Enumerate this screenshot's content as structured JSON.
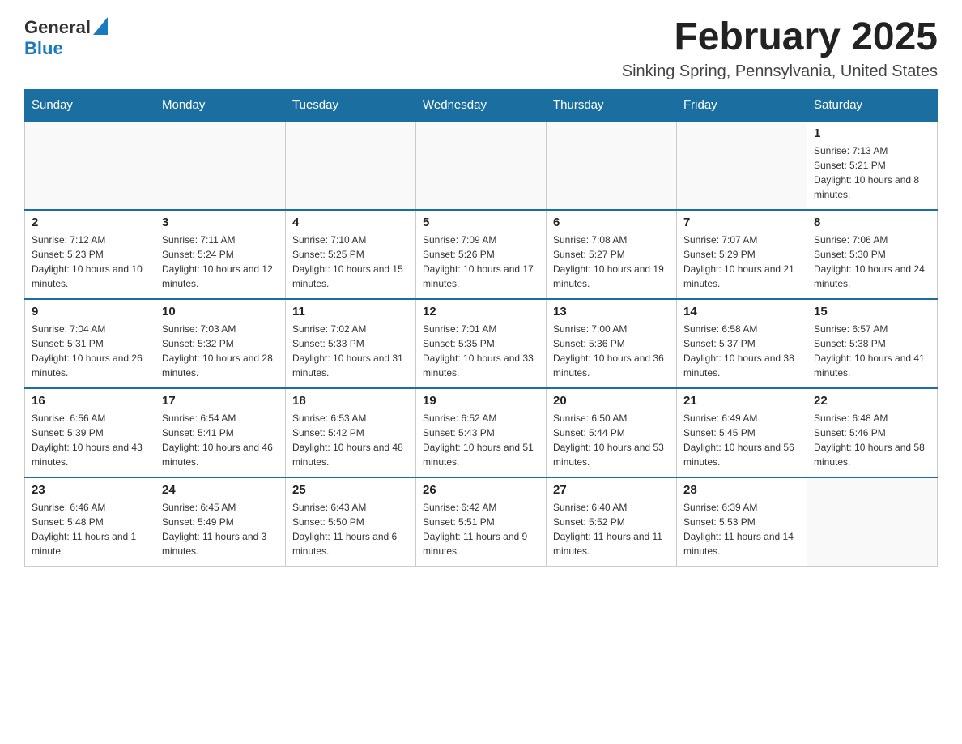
{
  "header": {
    "logo_general": "General",
    "logo_blue": "Blue",
    "month_title": "February 2025",
    "subtitle": "Sinking Spring, Pennsylvania, United States"
  },
  "days_of_week": [
    "Sunday",
    "Monday",
    "Tuesday",
    "Wednesday",
    "Thursday",
    "Friday",
    "Saturday"
  ],
  "weeks": [
    {
      "days": [
        {
          "number": "",
          "info": ""
        },
        {
          "number": "",
          "info": ""
        },
        {
          "number": "",
          "info": ""
        },
        {
          "number": "",
          "info": ""
        },
        {
          "number": "",
          "info": ""
        },
        {
          "number": "",
          "info": ""
        },
        {
          "number": "1",
          "info": "Sunrise: 7:13 AM\nSunset: 5:21 PM\nDaylight: 10 hours and 8 minutes."
        }
      ]
    },
    {
      "days": [
        {
          "number": "2",
          "info": "Sunrise: 7:12 AM\nSunset: 5:23 PM\nDaylight: 10 hours and 10 minutes."
        },
        {
          "number": "3",
          "info": "Sunrise: 7:11 AM\nSunset: 5:24 PM\nDaylight: 10 hours and 12 minutes."
        },
        {
          "number": "4",
          "info": "Sunrise: 7:10 AM\nSunset: 5:25 PM\nDaylight: 10 hours and 15 minutes."
        },
        {
          "number": "5",
          "info": "Sunrise: 7:09 AM\nSunset: 5:26 PM\nDaylight: 10 hours and 17 minutes."
        },
        {
          "number": "6",
          "info": "Sunrise: 7:08 AM\nSunset: 5:27 PM\nDaylight: 10 hours and 19 minutes."
        },
        {
          "number": "7",
          "info": "Sunrise: 7:07 AM\nSunset: 5:29 PM\nDaylight: 10 hours and 21 minutes."
        },
        {
          "number": "8",
          "info": "Sunrise: 7:06 AM\nSunset: 5:30 PM\nDaylight: 10 hours and 24 minutes."
        }
      ]
    },
    {
      "days": [
        {
          "number": "9",
          "info": "Sunrise: 7:04 AM\nSunset: 5:31 PM\nDaylight: 10 hours and 26 minutes."
        },
        {
          "number": "10",
          "info": "Sunrise: 7:03 AM\nSunset: 5:32 PM\nDaylight: 10 hours and 28 minutes."
        },
        {
          "number": "11",
          "info": "Sunrise: 7:02 AM\nSunset: 5:33 PM\nDaylight: 10 hours and 31 minutes."
        },
        {
          "number": "12",
          "info": "Sunrise: 7:01 AM\nSunset: 5:35 PM\nDaylight: 10 hours and 33 minutes."
        },
        {
          "number": "13",
          "info": "Sunrise: 7:00 AM\nSunset: 5:36 PM\nDaylight: 10 hours and 36 minutes."
        },
        {
          "number": "14",
          "info": "Sunrise: 6:58 AM\nSunset: 5:37 PM\nDaylight: 10 hours and 38 minutes."
        },
        {
          "number": "15",
          "info": "Sunrise: 6:57 AM\nSunset: 5:38 PM\nDaylight: 10 hours and 41 minutes."
        }
      ]
    },
    {
      "days": [
        {
          "number": "16",
          "info": "Sunrise: 6:56 AM\nSunset: 5:39 PM\nDaylight: 10 hours and 43 minutes."
        },
        {
          "number": "17",
          "info": "Sunrise: 6:54 AM\nSunset: 5:41 PM\nDaylight: 10 hours and 46 minutes."
        },
        {
          "number": "18",
          "info": "Sunrise: 6:53 AM\nSunset: 5:42 PM\nDaylight: 10 hours and 48 minutes."
        },
        {
          "number": "19",
          "info": "Sunrise: 6:52 AM\nSunset: 5:43 PM\nDaylight: 10 hours and 51 minutes."
        },
        {
          "number": "20",
          "info": "Sunrise: 6:50 AM\nSunset: 5:44 PM\nDaylight: 10 hours and 53 minutes."
        },
        {
          "number": "21",
          "info": "Sunrise: 6:49 AM\nSunset: 5:45 PM\nDaylight: 10 hours and 56 minutes."
        },
        {
          "number": "22",
          "info": "Sunrise: 6:48 AM\nSunset: 5:46 PM\nDaylight: 10 hours and 58 minutes."
        }
      ]
    },
    {
      "days": [
        {
          "number": "23",
          "info": "Sunrise: 6:46 AM\nSunset: 5:48 PM\nDaylight: 11 hours and 1 minute."
        },
        {
          "number": "24",
          "info": "Sunrise: 6:45 AM\nSunset: 5:49 PM\nDaylight: 11 hours and 3 minutes."
        },
        {
          "number": "25",
          "info": "Sunrise: 6:43 AM\nSunset: 5:50 PM\nDaylight: 11 hours and 6 minutes."
        },
        {
          "number": "26",
          "info": "Sunrise: 6:42 AM\nSunset: 5:51 PM\nDaylight: 11 hours and 9 minutes."
        },
        {
          "number": "27",
          "info": "Sunrise: 6:40 AM\nSunset: 5:52 PM\nDaylight: 11 hours and 11 minutes."
        },
        {
          "number": "28",
          "info": "Sunrise: 6:39 AM\nSunset: 5:53 PM\nDaylight: 11 hours and 14 minutes."
        },
        {
          "number": "",
          "info": ""
        }
      ]
    }
  ]
}
